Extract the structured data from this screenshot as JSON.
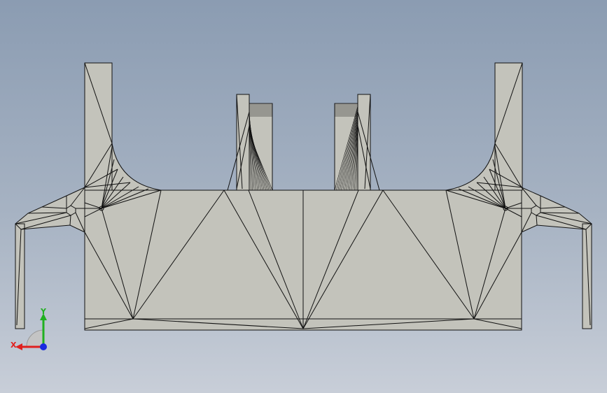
{
  "viewport": {
    "background_top": "#8b9cb2",
    "background_bottom": "#c8ced8"
  },
  "model": {
    "face_color": "#c3c3bb",
    "edge_color": "#111111"
  },
  "triad": {
    "x_label": "X",
    "y_label": "Y",
    "x_color": "#e0201e",
    "y_color": "#20b020",
    "z_color": "#1a2ae0"
  }
}
